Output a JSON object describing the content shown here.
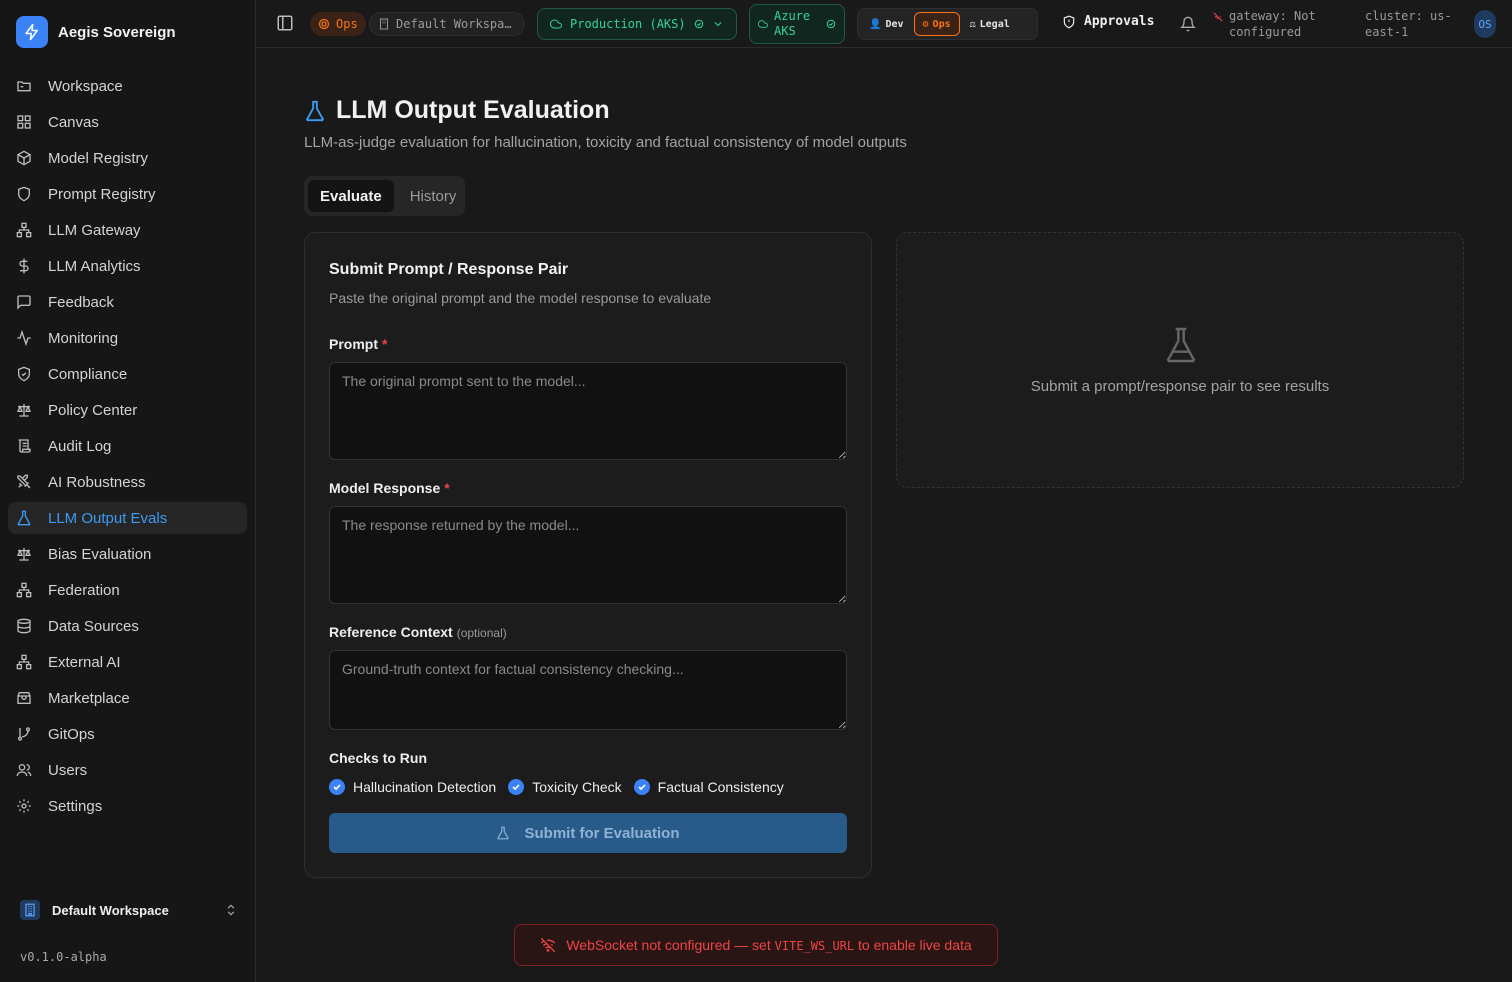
{
  "brand": {
    "name": "Aegis Sovereign",
    "logo": "bolt-icon",
    "accent": "#3b82f6"
  },
  "sidebar": {
    "items": [
      {
        "label": "Workspace",
        "icon": "folder-icon"
      },
      {
        "label": "Canvas",
        "icon": "grid-icon"
      },
      {
        "label": "Model Registry",
        "icon": "cube-icon"
      },
      {
        "label": "Prompt Registry",
        "icon": "shield-icon"
      },
      {
        "label": "LLM Gateway",
        "icon": "network-icon"
      },
      {
        "label": "LLM Analytics",
        "icon": "dollar-icon"
      },
      {
        "label": "Feedback",
        "icon": "message-icon"
      },
      {
        "label": "Monitoring",
        "icon": "activity-icon"
      },
      {
        "label": "Compliance",
        "icon": "shield-check-icon"
      },
      {
        "label": "Policy Center",
        "icon": "scale-icon"
      },
      {
        "label": "Audit Log",
        "icon": "scroll-icon"
      },
      {
        "label": "AI Robustness",
        "icon": "swords-icon"
      },
      {
        "label": "LLM Output Evals",
        "icon": "flask-icon",
        "active": true
      },
      {
        "label": "Bias Evaluation",
        "icon": "scale-icon"
      },
      {
        "label": "Federation",
        "icon": "network-icon"
      },
      {
        "label": "Data Sources",
        "icon": "database-icon"
      },
      {
        "label": "External AI",
        "icon": "network-icon"
      },
      {
        "label": "Marketplace",
        "icon": "store-icon"
      },
      {
        "label": "GitOps",
        "icon": "git-branch-icon"
      },
      {
        "label": "Users",
        "icon": "users-icon"
      },
      {
        "label": "Settings",
        "icon": "gear-icon"
      }
    ],
    "workspace_switcher": "Default Workspace",
    "version": "v0.1.0-alpha"
  },
  "topbar": {
    "ops_badge": "Ops",
    "workspace": "Default Workspa…",
    "environment": "Production (AKS)",
    "cloud_line1": "Azure",
    "cloud_line2": "AKS",
    "personas": [
      {
        "label": "Dev"
      },
      {
        "label": "Ops",
        "active": true
      },
      {
        "label": "Legal"
      }
    ],
    "approvals": "Approvals",
    "gateway_line1": "gateway: Not",
    "gateway_line2": "configured",
    "cluster_line1": "cluster: us-",
    "cluster_line2": "east-1",
    "avatar": "OS"
  },
  "page": {
    "title": "LLM Output Evaluation",
    "subtitle": "LLM-as-judge evaluation for hallucination, toxicity and factual consistency of model outputs",
    "tabs": [
      {
        "label": "Evaluate",
        "active": true
      },
      {
        "label": "History"
      }
    ]
  },
  "form": {
    "title": "Submit Prompt / Response Pair",
    "subtitle": "Paste the original prompt and the model response to evaluate",
    "prompt_label": "Prompt",
    "prompt_placeholder": "The original prompt sent to the model...",
    "response_label": "Model Response",
    "response_placeholder": "The response returned by the model...",
    "context_label": "Reference Context",
    "context_optional": "(optional)",
    "context_placeholder": "Ground-truth context for factual consistency checking...",
    "required_mark": "*",
    "checks_label": "Checks to Run",
    "checks": [
      {
        "label": "Hallucination Detection",
        "checked": true
      },
      {
        "label": "Toxicity Check",
        "checked": true
      },
      {
        "label": "Factual Consistency",
        "checked": true
      }
    ],
    "submit_label": "Submit for Evaluation"
  },
  "results": {
    "empty_message": "Submit a prompt/response pair to see results"
  },
  "toast": {
    "text_before": "WebSocket not configured — set",
    "code": "VITE_WS_URL",
    "text_after": "to enable live data"
  },
  "colors": {
    "accent": "#3b82f6",
    "ops": "#f97316",
    "success": "#34d399",
    "danger": "#ef4444"
  }
}
